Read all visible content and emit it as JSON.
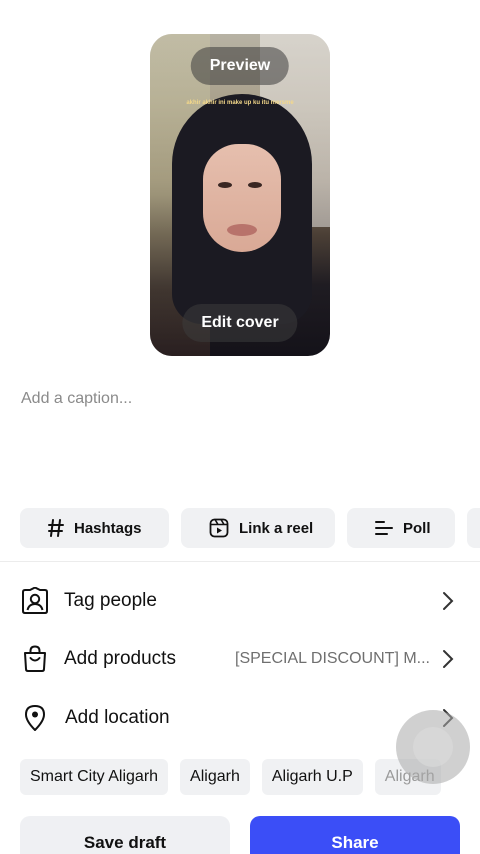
{
  "preview": {
    "preview_label": "Preview",
    "edit_cover_label": "Edit cover",
    "overlay_text": "akhir akhir ini make up ku itu mersme"
  },
  "caption": {
    "placeholder": "Add a caption..."
  },
  "chips": {
    "hashtags": "Hashtags",
    "link_reel": "Link a reel",
    "poll": "Poll"
  },
  "rows": {
    "tag_people": "Tag people",
    "add_products": "Add products",
    "add_products_value": "[SPECIAL DISCOUNT] M...",
    "add_location": "Add location"
  },
  "location_suggestions": [
    "Smart City Aligarh",
    "Aligarh",
    "Aligarh U.P",
    "Aligarh"
  ],
  "buttons": {
    "save_draft": "Save draft",
    "share": "Share"
  },
  "colors": {
    "share_button": "#3b4ef7",
    "chip_bg": "#f0f1f3"
  },
  "icons": [
    "hashtag-icon",
    "reel-icon",
    "poll-icon",
    "tag-person-icon",
    "shopping-bag-icon",
    "location-pin-icon",
    "chevron-right-icon"
  ]
}
